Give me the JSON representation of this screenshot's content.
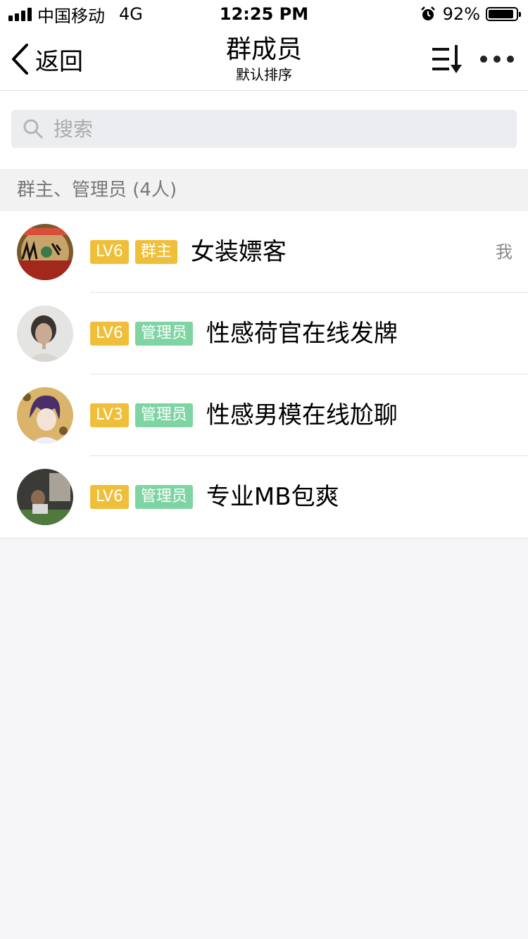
{
  "status_bar": {
    "carrier": "中国移动",
    "network": "4G",
    "time": "12:25 PM",
    "battery_percent": "92%",
    "battery_level": 0.92
  },
  "nav": {
    "back_label": "返回",
    "title": "群成员",
    "subtitle": "默认排序",
    "sort_icon": "sort-descending-icon",
    "more_icon": "more-dots-icon"
  },
  "search": {
    "placeholder": "搜索"
  },
  "section": {
    "header": "群主、管理员 (4人)"
  },
  "members": [
    {
      "level": "LV6",
      "role": "群主",
      "role_type": "owner",
      "name": "女装嫖客",
      "self_tag": "我"
    },
    {
      "level": "LV6",
      "role": "管理员",
      "role_type": "admin",
      "name": "性感荷官在线发牌"
    },
    {
      "level": "LV3",
      "role": "管理员",
      "role_type": "admin",
      "name": "性感男模在线尬聊"
    },
    {
      "level": "LV6",
      "role": "管理员",
      "role_type": "admin",
      "name": "专业MB包爽"
    }
  ],
  "colors": {
    "level_badge": "#f0bf3a",
    "owner_badge": "#f0bf3a",
    "admin_badge": "#7fd4a3"
  }
}
